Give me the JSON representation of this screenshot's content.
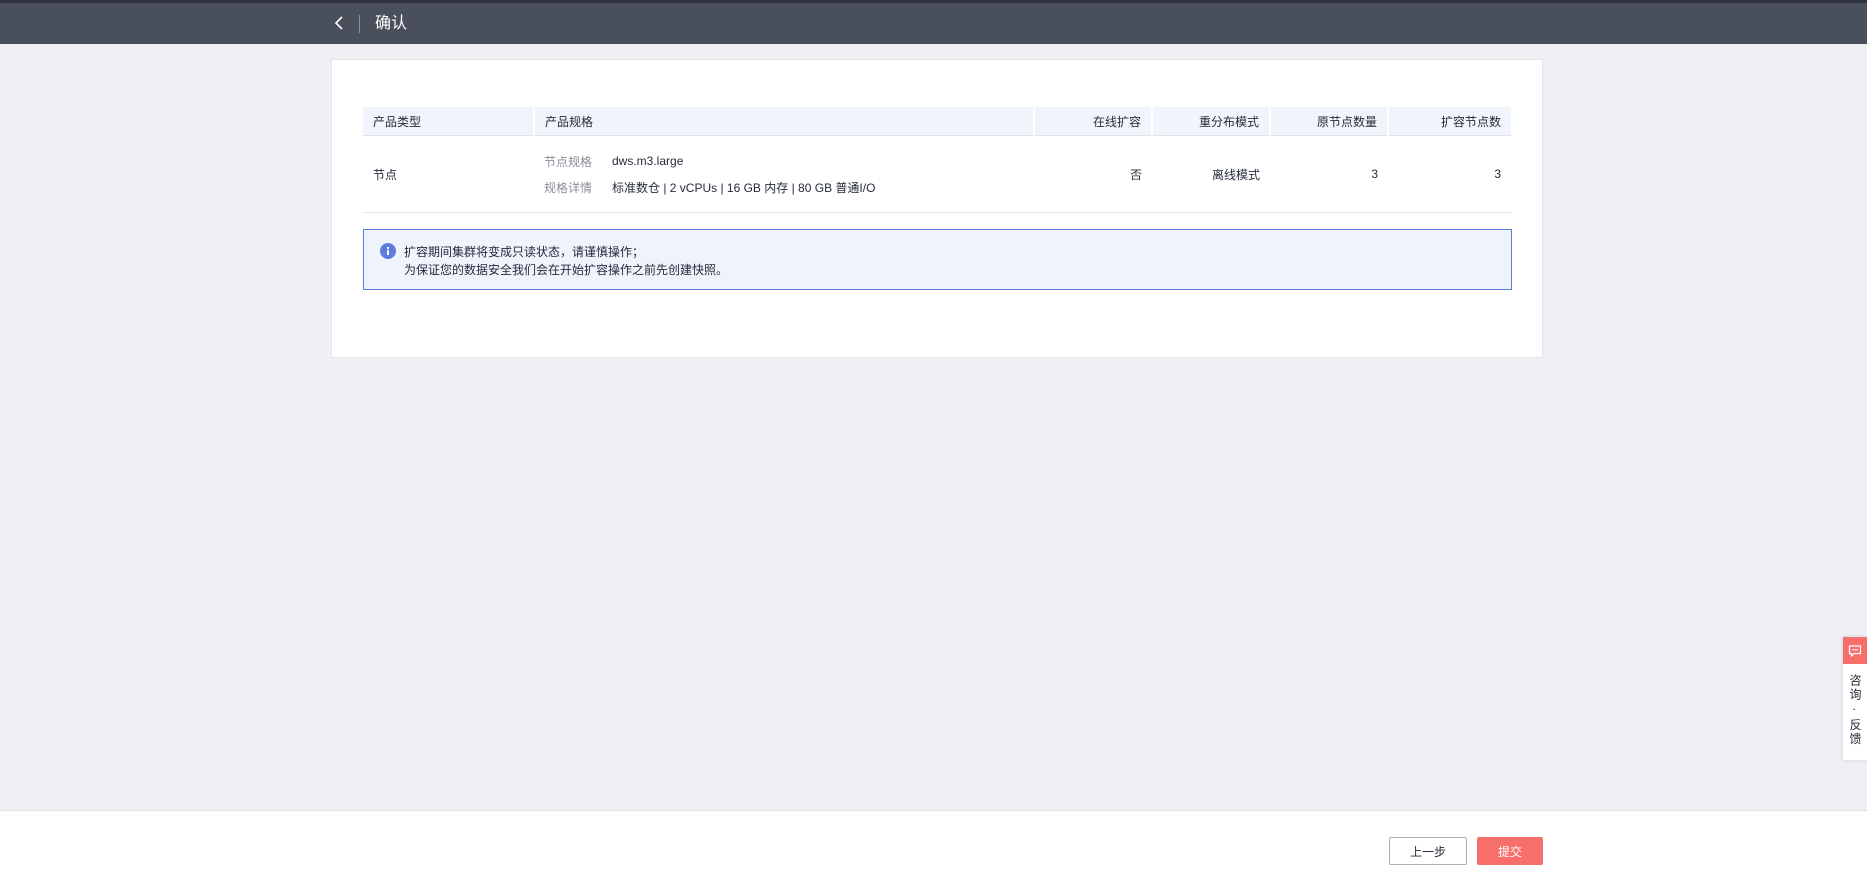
{
  "header": {
    "title": "确认",
    "back_icon": "chevron-left-icon"
  },
  "table": {
    "columns": [
      "产品类型",
      "产品规格",
      "在线扩容",
      "重分布模式",
      "原节点数量",
      "扩容节点数"
    ],
    "row": {
      "product_type": "节点",
      "spec_label": "节点规格",
      "spec_value": "dws.m3.large",
      "detail_label": "规格详情",
      "detail_value": "标准数仓 | 2 vCPUs | 16 GB 内存 | 80 GB 普通I/O",
      "online_expansion": "否",
      "redistribution_mode": "离线模式",
      "original_nodes": "3",
      "expansion_nodes": "3"
    }
  },
  "notice": {
    "icon": "info-icon",
    "line1": "扩容期间集群将变成只读状态，请谨慎操作；",
    "line2": "为保证您的数据安全我们会在开始扩容操作之前先创建快照。"
  },
  "float_panel": {
    "icon": "chat-icon",
    "label": "咨询 · 反馈"
  },
  "footer": {
    "prev_label": "上一步",
    "submit_label": "提交"
  },
  "colors": {
    "header_bg": "#4a4f5c",
    "accent": "#5e7ce0",
    "submit": "#f66f6a",
    "page_bg": "#eff0f4"
  }
}
